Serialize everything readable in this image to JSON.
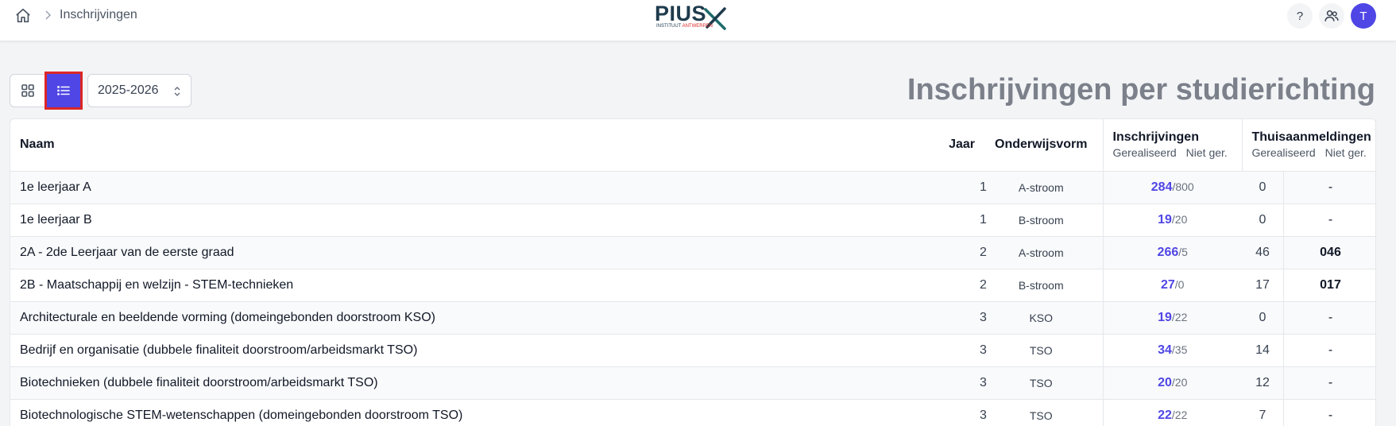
{
  "breadcrumb": {
    "current": "Inschrijvingen"
  },
  "logo": {
    "word": "PIUS",
    "sub_dark": "INSTITUUT",
    "sub_red": "ANTWERPEN"
  },
  "header": {
    "help_label": "?",
    "avatar_initial": "T"
  },
  "controls": {
    "school_year": "2025-2026",
    "active_view": "list"
  },
  "page_title": "Inschrijvingen per studierichting",
  "table": {
    "headers": {
      "naam": "Naam",
      "jaar": "Jaar",
      "onderwijsvorm": "Onderwijsvorm",
      "inschrijvingen": "Inschrijvingen",
      "thuisaanmeldingen": "Thuisaanmeldingen",
      "gerealiseerd": "Gerealiseerd",
      "niet_ger": "Niet ger."
    },
    "rows": [
      {
        "naam": "1e leerjaar A",
        "jaar": "1",
        "onderwijsvorm": "A-stroom",
        "gerealiseerd": "284",
        "capaciteit": "/800",
        "niet_ger": "0",
        "thuis_ger": "-",
        "thuis_niet_ger": ""
      },
      {
        "naam": "1e leerjaar B",
        "jaar": "1",
        "onderwijsvorm": "B-stroom",
        "gerealiseerd": "19",
        "capaciteit": "/20",
        "niet_ger": "0",
        "thuis_ger": "-",
        "thuis_niet_ger": ""
      },
      {
        "naam": "2A - 2de Leerjaar van de eerste graad",
        "jaar": "2",
        "onderwijsvorm": "A-stroom",
        "gerealiseerd": "266",
        "capaciteit": "/5",
        "niet_ger": "46",
        "thuis_ger": "0",
        "thuis_niet_ger": "46"
      },
      {
        "naam": "2B - Maatschappij en welzijn - STEM-technieken",
        "jaar": "2",
        "onderwijsvorm": "B-stroom",
        "gerealiseerd": "27",
        "capaciteit": "/0",
        "niet_ger": "17",
        "thuis_ger": "0",
        "thuis_niet_ger": "17"
      },
      {
        "naam": "Architecturale en beeldende vorming (domeingebonden doorstroom KSO)",
        "jaar": "3",
        "onderwijsvorm": "KSO",
        "gerealiseerd": "19",
        "capaciteit": "/22",
        "niet_ger": "0",
        "thuis_ger": "-",
        "thuis_niet_ger": ""
      },
      {
        "naam": "Bedrijf en organisatie (dubbele finaliteit doorstroom/arbeidsmarkt TSO)",
        "jaar": "3",
        "onderwijsvorm": "TSO",
        "gerealiseerd": "34",
        "capaciteit": "/35",
        "niet_ger": "14",
        "thuis_ger": "-",
        "thuis_niet_ger": ""
      },
      {
        "naam": "Biotechnieken (dubbele finaliteit doorstroom/arbeidsmarkt TSO)",
        "jaar": "3",
        "onderwijsvorm": "TSO",
        "gerealiseerd": "20",
        "capaciteit": "/20",
        "niet_ger": "12",
        "thuis_ger": "-",
        "thuis_niet_ger": ""
      },
      {
        "naam": "Biotechnologische STEM-wetenschappen (domeingebonden doorstroom TSO)",
        "jaar": "3",
        "onderwijsvorm": "TSO",
        "gerealiseerd": "22",
        "capaciteit": "/22",
        "niet_ger": "7",
        "thuis_ger": "-",
        "thuis_niet_ger": ""
      }
    ]
  },
  "colors": {
    "accent": "#4f46e5",
    "highlight_border": "#dc2626",
    "title_gray": "#7b808a"
  },
  "icons": [
    "home-icon",
    "chevron-right-icon",
    "help-icon",
    "users-icon",
    "grid-icon",
    "list-icon",
    "select-chevrons-icon"
  ]
}
